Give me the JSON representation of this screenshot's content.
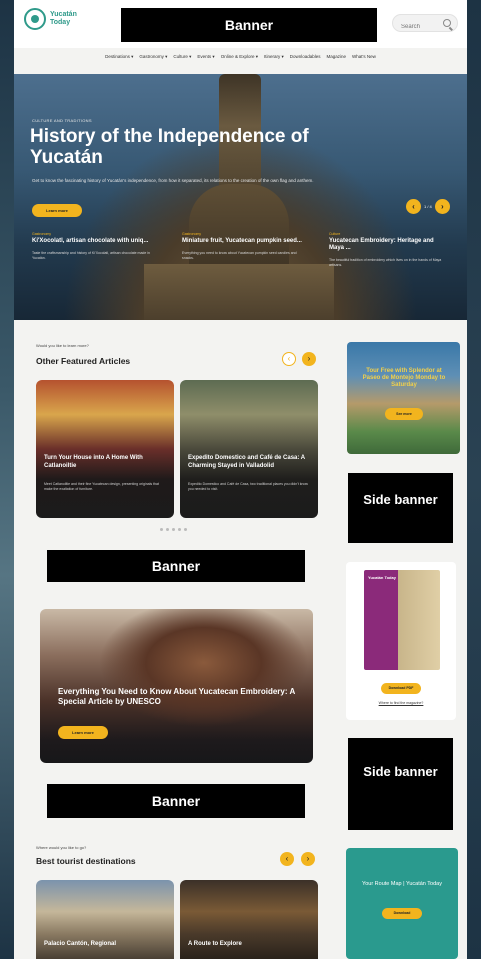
{
  "header": {
    "logo_text": "Yucatán Today",
    "banner_label": "Banner",
    "search_placeholder": "Search"
  },
  "nav": {
    "items": [
      "Destinations ▾",
      "Gastronomy ▾",
      "Culture ▾",
      "Events ▾",
      "Online & Explore ▾",
      "Itinerary ▾",
      "Downloadables",
      "Magazine",
      "What's New"
    ]
  },
  "hero": {
    "kicker": "CULTURE AND TRADITIONS",
    "title": "History of the Independence of Yucatán",
    "description": "Get to know the fascinating history of Yucatán's independence, from how it separated, its relations to the creation of the own flag and anthem.",
    "button_label": "Learn more",
    "prev_symbol": "‹",
    "next_symbol": "›",
    "counter": "1 / 4",
    "cards": [
      {
        "category": "Gastronomy",
        "title": "Ki'Xocolatl, artisan chocolate with uniq...",
        "description": "Taste the craftsmanship and history of Ki'Xocolatl, artisan chocolate made in Yucatán."
      },
      {
        "category": "Gastronomy",
        "title": "Miniature fruit, Yucatecan pumpkin seed...",
        "description": "Everything you need to know about Yucatecan pumpkin seed candies and snacks."
      },
      {
        "category": "Culture",
        "title": "Yucatecan Embroidery: Heritage and Maya ...",
        "description": "The beautiful tradition of embroidery which lives on in the hands of Maya artisans."
      }
    ]
  },
  "featured": {
    "kicker": "Would you like to learn more?",
    "title": "Other Featured Articles",
    "prev_symbol": "‹",
    "next_symbol": "›",
    "cards": [
      {
        "title": "Turn Your House into A Home With Catlanoiltie",
        "description": "Meet Catlanoiltie and their fine Yucatecan design, presenting originals that make the exaltation of furniture."
      },
      {
        "title": "Expedito Domestico and Café de Casa: A Charming Stayed in Valladolid",
        "description": "Expedito Domestico and Café de Casa, two traditional places you didn't know you needed to visit."
      }
    ],
    "dots": [
      "•",
      "•",
      "•",
      "•",
      "•"
    ]
  },
  "banner_mid_1": "Banner",
  "embroidery": {
    "title": "Everything You Need to Know About Yucatecan Embroidery: A Special Article by UNESCO",
    "button_label": "Learn more"
  },
  "banner_mid_2": "Banner",
  "destinations": {
    "kicker": "Where would you like to go?",
    "title": "Best tourist destinations",
    "prev_symbol": "‹",
    "next_symbol": "›",
    "cards": [
      {
        "title": "Palacio Cantón, Regional"
      },
      {
        "title": "A Route to Explore"
      }
    ]
  },
  "sidebar": {
    "tour_title": "Tour Free with Splendor at Paseo de Montejo Monday to Saturday",
    "tour_button": "See more",
    "side_banner_1": "Side banner",
    "brochure_caption": "Yucatán Today",
    "brochure_button": "Download PDF",
    "brochure_link": "Where to find the magazine?",
    "side_banner_2": "Side banner",
    "map_title": "Your Route Map | Yucatán Today",
    "map_button": "Download"
  },
  "colors": {
    "accent": "#f2b41e",
    "brand_teal": "#2f9a8a",
    "page_bg": "#f3f3f1"
  }
}
